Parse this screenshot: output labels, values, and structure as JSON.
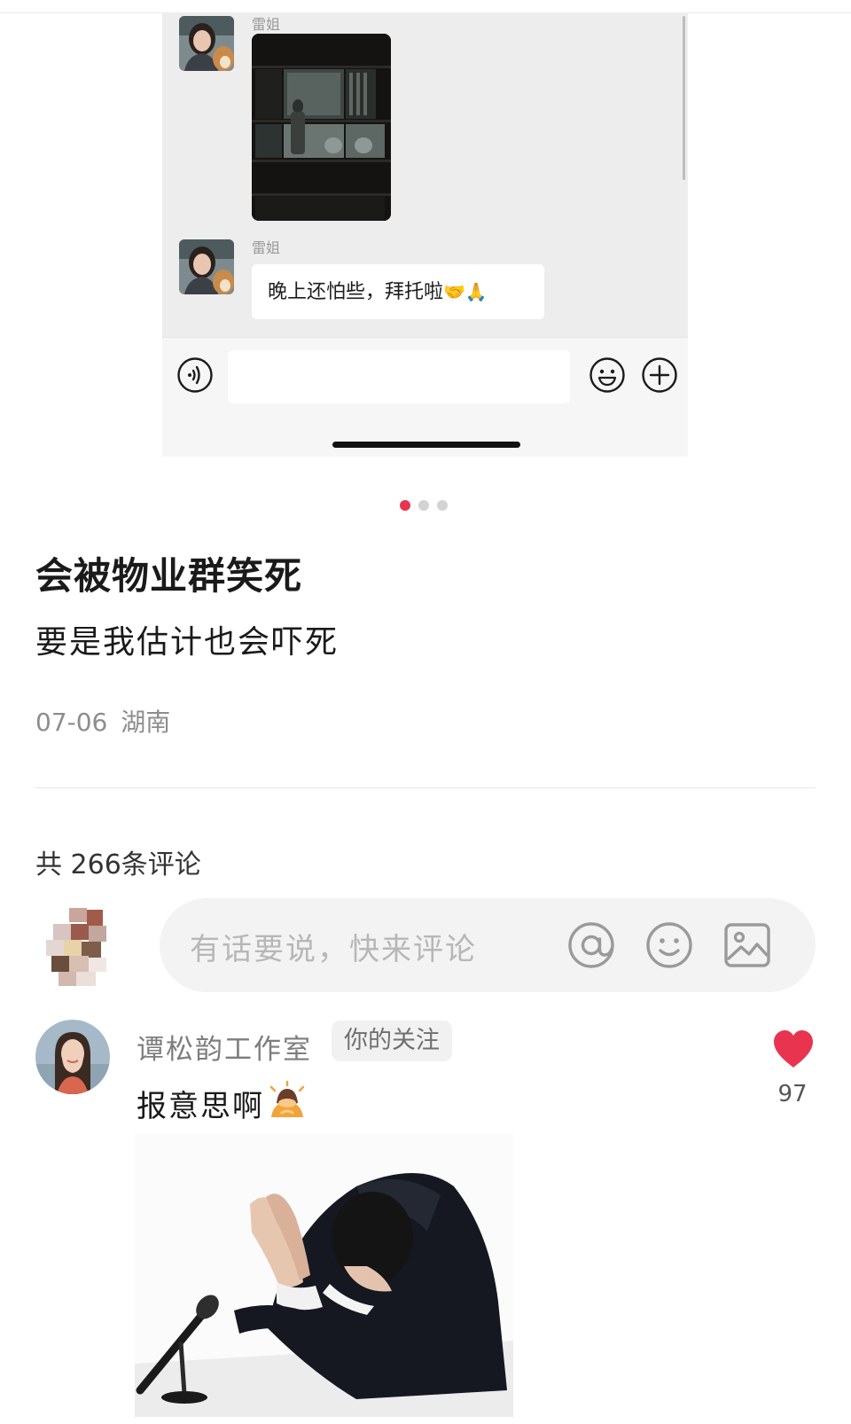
{
  "chat": {
    "messages": [
      {
        "sender": "雷姐",
        "type": "image"
      },
      {
        "sender": "雷姐",
        "type": "text",
        "text": "晚上还怕些，拜托啦",
        "emojis": "🤝🙏"
      }
    ]
  },
  "carousel": {
    "count": 3,
    "active": 1,
    "active_color": "#e8344e"
  },
  "post": {
    "title": "会被物业群笑死",
    "body": "要是我估计也会吓死",
    "date": "07-06",
    "location": "湖南"
  },
  "comments": {
    "total_label": "共 266条评论",
    "input": {
      "placeholder": "有话要说，快来评论",
      "icons": [
        "at-icon",
        "emoji-icon",
        "image-icon"
      ]
    },
    "items": [
      {
        "author": "谭松韵工作室",
        "tag": "你的关注",
        "text": "报意思啊",
        "emoji": "🙇",
        "likes": "97"
      }
    ]
  },
  "colors": {
    "like_red": "#e8344e",
    "divider": "#e6e6e6"
  }
}
